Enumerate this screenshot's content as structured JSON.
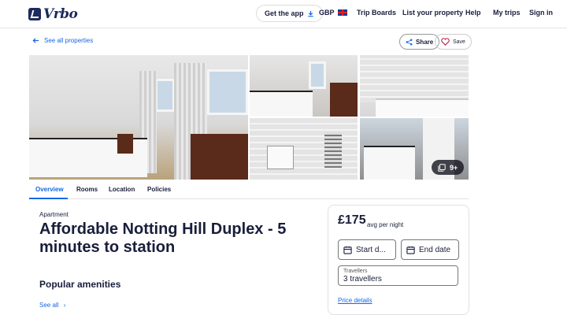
{
  "header": {
    "brand": "Vrbo",
    "get_app": "Get the app",
    "currency": "GBP",
    "trip_boards": "Trip Boards",
    "list_property": "List your property",
    "help": "Help",
    "my_trips": "My trips",
    "sign_in": "Sign in"
  },
  "toolbar": {
    "back": "See all properties",
    "share": "Share",
    "save": "Save"
  },
  "gallery": {
    "more_count": "9+"
  },
  "tabs": [
    "Overview",
    "Rooms",
    "Location",
    "Policies"
  ],
  "listing": {
    "type": "Apartment",
    "title": "Affordable Notting Hill Duplex - 5 minutes to station",
    "amenities_heading": "Popular amenities",
    "see_all": "See all"
  },
  "booking": {
    "price": "£175",
    "per_night": "avg per night",
    "start_date": "Start d...",
    "end_date": "End date",
    "travellers_label": "Travellers",
    "travellers_value": "3 travellers",
    "price_details": "Price details"
  },
  "colors": {
    "accent": "#1668e3",
    "brand": "#1c2a5c",
    "text": "#191e3b"
  }
}
